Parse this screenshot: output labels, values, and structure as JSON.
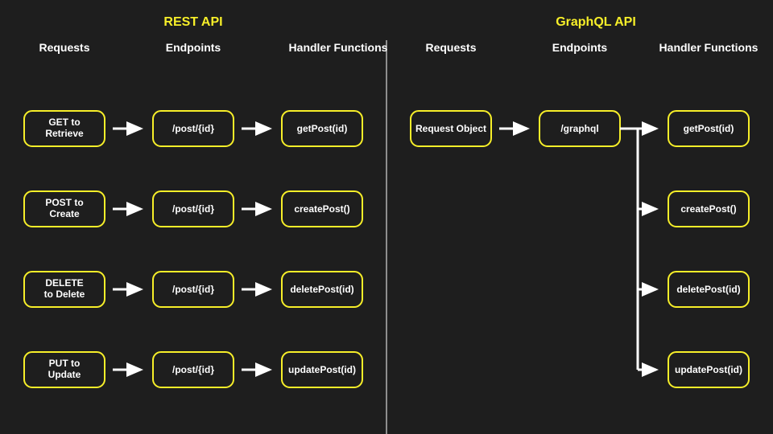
{
  "rest": {
    "title": "REST API",
    "columns": {
      "requests": "Requests",
      "endpoints": "Endpoints",
      "handlers": "Handler Functions"
    },
    "rows": [
      {
        "request_l1": "GET to",
        "request_l2": "Retrieve",
        "endpoint": "/post/{id}",
        "handler": "getPost(id)"
      },
      {
        "request_l1": "POST to",
        "request_l2": "Create",
        "endpoint": "/post/{id}",
        "handler": "createPost()"
      },
      {
        "request_l1": "DELETE",
        "request_l2": "to Delete",
        "endpoint": "/post/{id}",
        "handler": "deletePost(id)"
      },
      {
        "request_l1": "PUT to",
        "request_l2": "Update",
        "endpoint": "/post/{id}",
        "handler": "updatePost(id)"
      }
    ]
  },
  "graphql": {
    "title": "GraphQL API",
    "columns": {
      "requests": "Requests",
      "endpoints": "Endpoints",
      "handlers": "Handler Functions"
    },
    "request": "Request Object",
    "endpoint": "/graphql",
    "handlers": [
      "getPost(id)",
      "createPost()",
      "deletePost(id)",
      "updatePost(id)"
    ]
  }
}
